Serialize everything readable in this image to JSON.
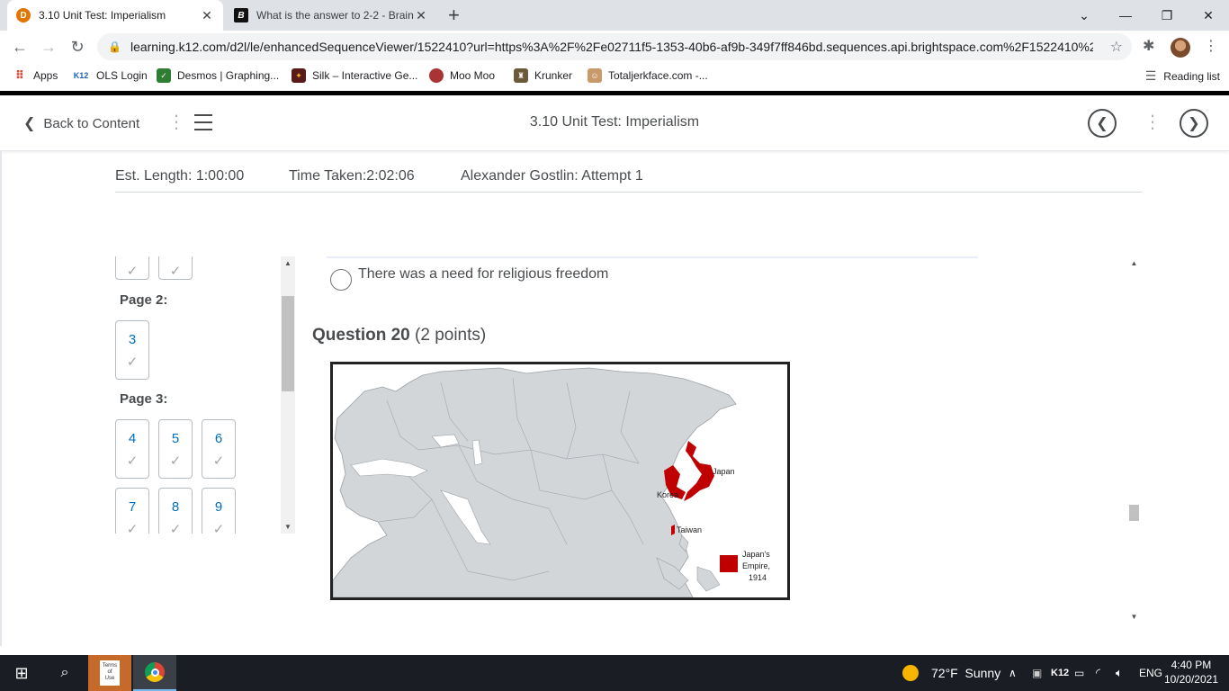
{
  "browser": {
    "tabs": [
      {
        "title": "3.10 Unit Test: Imperialism",
        "active": true,
        "favicon": "brightspace-icon"
      },
      {
        "title": "What is the answer to 2-2 - Brain",
        "active": false,
        "favicon": "brainly-icon"
      }
    ],
    "url": "learning.k12.com/d2l/le/enhancedSequenceViewer/1522410?url=https%3A%2F%2Fe02711f5-1353-40b6-af9b-349f7ff846bd.sequences.api.brightspace.com%2F1522410%2F...",
    "bookmarks": [
      {
        "label": "Apps",
        "icon": "apps-grid-icon"
      },
      {
        "label": "OLS Login",
        "icon": "k12-icon"
      },
      {
        "label": "Desmos | Graphing...",
        "icon": "desmos-icon"
      },
      {
        "label": "Silk – Interactive Ge...",
        "icon": "silk-icon"
      },
      {
        "label": "Moo Moo",
        "icon": "moomoo-icon"
      },
      {
        "label": "Krunker",
        "icon": "krunker-icon"
      },
      {
        "label": "Totaljerkface.com -...",
        "icon": "totaljerkface-icon"
      }
    ],
    "reading_list": "Reading list",
    "k12_badge": "K12"
  },
  "header": {
    "back_label": "Back to Content",
    "title": "3.10 Unit Test: Imperialism"
  },
  "info": {
    "est_length": "Est. Length: 1:00:00",
    "time_taken": "Time Taken:2:02:06",
    "attempt": "Alexander Gostlin: Attempt 1"
  },
  "nav": {
    "page2_label": "Page 2:",
    "page3_label": "Page 3:",
    "questions": [
      "3",
      "4",
      "5",
      "6",
      "7",
      "8",
      "9"
    ],
    "check_glyph": "✓"
  },
  "question": {
    "option_text": "There was a need for religious freedom",
    "number_label": "Question 20",
    "points_label": "(2 points)",
    "map_labels": {
      "japan": "Japan",
      "korea": "Korea",
      "taiwan": "Taiwan",
      "legend_line1": "Japan's",
      "legend_line2": "Empire,",
      "legend_line3": "1914"
    },
    "map_color": "#c00000"
  },
  "taskbar": {
    "terms_line1": "Terms",
    "terms_line2": "of",
    "terms_line3": "Use",
    "weather": "72°F  Sunny",
    "k12": "K12",
    "lang": "ENG",
    "time": "4:40 PM",
    "date": "10/20/2021"
  }
}
